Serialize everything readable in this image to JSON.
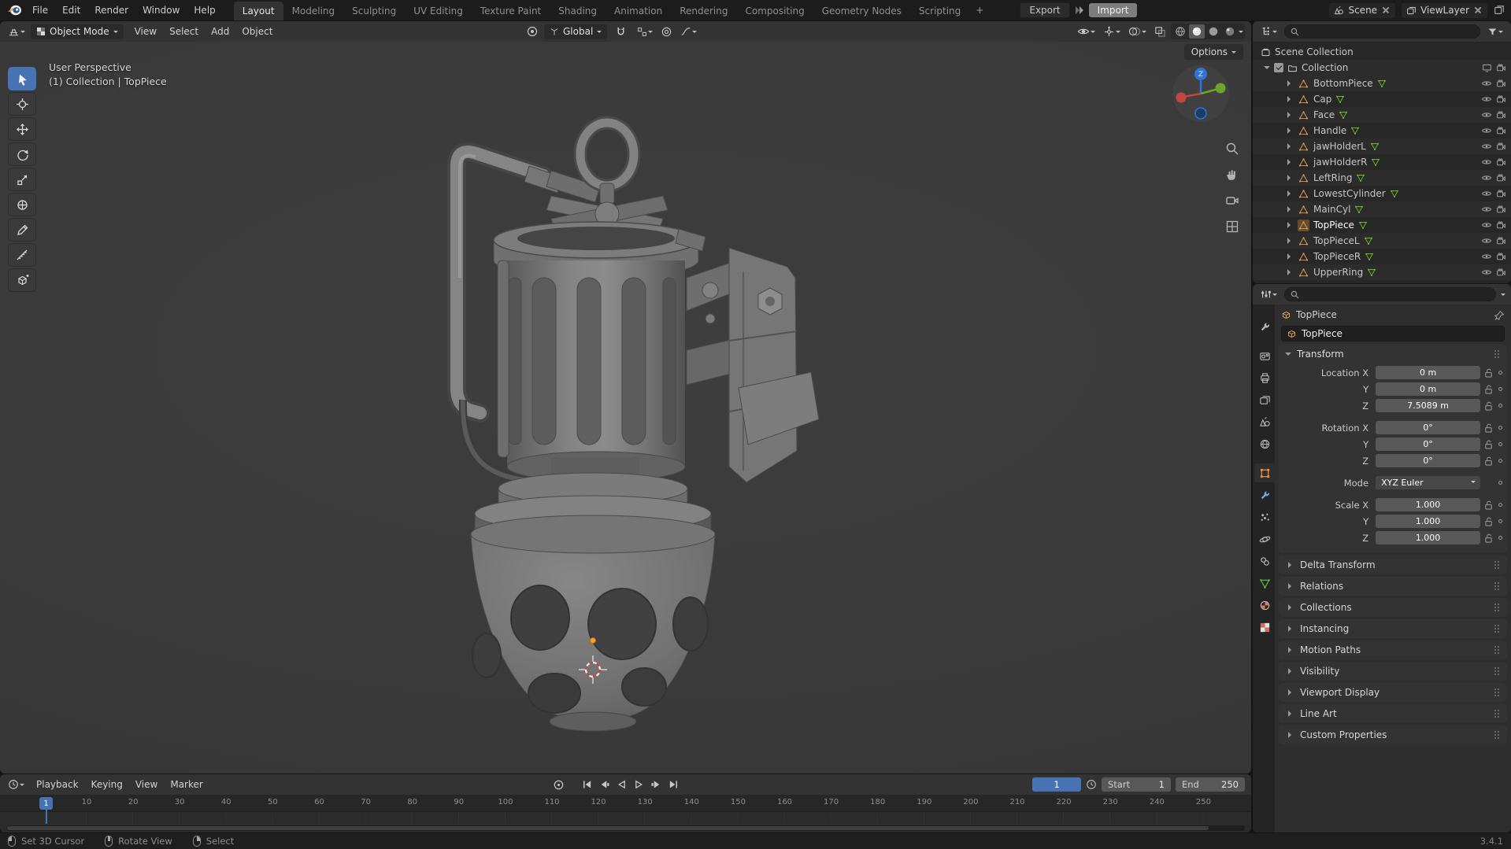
{
  "colors": {
    "accent": "#4772b3",
    "object_orange": "#e8923f",
    "mesh_green": "#72c02c",
    "axis_x": "#c4473d",
    "axis_y": "#6ba52e",
    "axis_z": "#2d73d8"
  },
  "topbar": {
    "menus": [
      "File",
      "Edit",
      "Render",
      "Window",
      "Help"
    ],
    "tabs": [
      {
        "label": "Layout",
        "active": true
      },
      {
        "label": "Modeling"
      },
      {
        "label": "Sculpting"
      },
      {
        "label": "UV Editing"
      },
      {
        "label": "Texture Paint"
      },
      {
        "label": "Shading"
      },
      {
        "label": "Animation"
      },
      {
        "label": "Rendering"
      },
      {
        "label": "Compositing"
      },
      {
        "label": "Geometry Nodes"
      },
      {
        "label": "Scripting"
      }
    ],
    "add_tab": "+",
    "export_label": "Export",
    "import_label": "Import",
    "scene": "Scene",
    "view_layer": "ViewLayer"
  },
  "viewport_header": {
    "mode": "Object Mode",
    "menus": [
      "View",
      "Select",
      "Add",
      "Object"
    ],
    "orientation": "Global",
    "options": "Options"
  },
  "viewport": {
    "overlay_line1": "User Perspective",
    "overlay_line2": "(1) Collection | TopPiece",
    "gizmo_z": "Z"
  },
  "outliner": {
    "root": "Scene Collection",
    "collection": "Collection",
    "items": [
      {
        "name": "BottomPiece"
      },
      {
        "name": "Cap"
      },
      {
        "name": "Face"
      },
      {
        "name": "Handle"
      },
      {
        "name": "jawHolderL"
      },
      {
        "name": "jawHolderR"
      },
      {
        "name": "LeftRing"
      },
      {
        "name": "LowestCylinder"
      },
      {
        "name": "MainCyl"
      },
      {
        "name": "TopPiece",
        "active": true
      },
      {
        "name": "TopPieceL"
      },
      {
        "name": "TopPieceR"
      },
      {
        "name": "UpperRing"
      }
    ]
  },
  "properties": {
    "breadcrumb_object": "TopPiece",
    "object_name": "TopPiece",
    "transform_label": "Transform",
    "transform_rows": [
      {
        "label": "Location X",
        "value": "0 m"
      },
      {
        "label": "Y",
        "value": "0 m"
      },
      {
        "label": "Z",
        "value": "7.5089 m"
      },
      {
        "label": "Rotation X",
        "value": "0°",
        "cls": "gap"
      },
      {
        "label": "Y",
        "value": "0°"
      },
      {
        "label": "Z",
        "value": "0°"
      },
      {
        "label": "Mode",
        "value": "XYZ Euler",
        "cls": "gap dropdown"
      },
      {
        "label": "Scale X",
        "value": "1.000",
        "cls": "gap"
      },
      {
        "label": "Y",
        "value": "1.000"
      },
      {
        "label": "Z",
        "value": "1.000"
      }
    ],
    "sections": [
      "Delta Transform",
      "Relations",
      "Collections",
      "Instancing",
      "Motion Paths",
      "Visibility",
      "Viewport Display",
      "Line Art",
      "Custom Properties"
    ],
    "tab_names": [
      "tool",
      "render",
      "output",
      "view-layer",
      "scene",
      "world",
      "object",
      "modifiers",
      "particles",
      "physics",
      "constraints",
      "object-data",
      "material",
      "texture"
    ]
  },
  "timeline": {
    "menus": [
      "Playback",
      "Keying",
      "View",
      "Marker"
    ],
    "current_frame": "1",
    "start_label": "Start",
    "start_value": "1",
    "end_label": "End",
    "end_value": "250",
    "ticks": [
      "10",
      "20",
      "30",
      "40",
      "50",
      "60",
      "70",
      "80",
      "90",
      "100",
      "110",
      "120",
      "130",
      "140",
      "150",
      "160",
      "170",
      "180",
      "190",
      "200",
      "210",
      "220",
      "230",
      "240",
      "250"
    ]
  },
  "statusbar": {
    "hints": [
      {
        "label": "Set 3D Cursor",
        "cls": "mouse-left"
      },
      {
        "label": "Rotate View",
        "cls": "mouse-middle"
      },
      {
        "label": "Select",
        "cls": "mouse-right"
      }
    ],
    "version": "3.4.1"
  },
  "icon_names": [
    "blender-logo",
    "search",
    "filter-funnel",
    "magnet",
    "pivot",
    "proportional",
    "falloff",
    "eye",
    "camera",
    "screen",
    "mesh",
    "mesh-data",
    "collection",
    "checkbox",
    "pin",
    "lock-open",
    "animate-dot",
    "grip",
    "wrench",
    "printer",
    "image-stack",
    "scene-cone",
    "world-globe",
    "object-square",
    "particles",
    "physics",
    "constraints",
    "material-sphere",
    "texture-checker",
    "clock",
    "auto-key",
    "skip-start",
    "prev-keyframe",
    "play-back",
    "play",
    "next-keyframe",
    "skip-end",
    "mouse-left",
    "mouse-middle",
    "mouse-right",
    "zoom",
    "pan-hand",
    "toggle-camera",
    "ortho-grid",
    "nav-gizmo",
    "overlays",
    "xray",
    "shading-wireframe",
    "shading-solid",
    "shading-material",
    "shading-rendered"
  ]
}
